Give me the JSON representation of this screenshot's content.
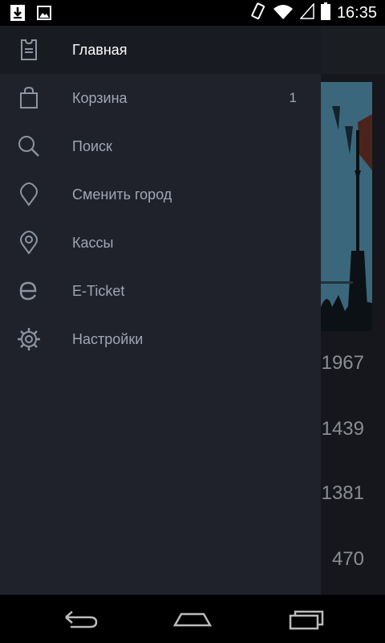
{
  "status_bar": {
    "time": "16:35",
    "left_icons": [
      "download-icon",
      "image-icon"
    ],
    "right_icons": [
      "vibrate-icon",
      "wifi-icon",
      "signal-icon",
      "battery-icon"
    ]
  },
  "drawer": {
    "items": [
      {
        "label": "Главная",
        "icon": "ticket-icon",
        "active": true,
        "count": ""
      },
      {
        "label": "Корзина",
        "icon": "bag-icon",
        "active": false,
        "count": "1"
      },
      {
        "label": "Поиск",
        "icon": "search-icon",
        "active": false,
        "count": ""
      },
      {
        "label": "Сменить город",
        "icon": "location-pin-icon",
        "active": false,
        "count": ""
      },
      {
        "label": "Кассы",
        "icon": "place-icon",
        "active": false,
        "count": ""
      },
      {
        "label": "E-Ticket",
        "icon": "e-ticket-icon",
        "active": false,
        "count": ""
      },
      {
        "label": "Настройки",
        "icon": "settings-icon",
        "active": false,
        "count": ""
      }
    ]
  },
  "background": {
    "numbers": [
      "1967",
      "1439",
      "1381",
      "470"
    ]
  },
  "colors": {
    "drawer_bg": "#1f222b",
    "active_bg": "#191b22",
    "label": "#9fa6b2",
    "active_label": "#ffffff"
  }
}
